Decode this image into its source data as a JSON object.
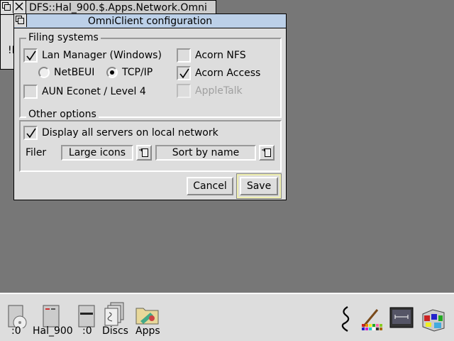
{
  "background_window": {
    "title": "DFS::Hal_900.$.Apps.Network.Omni",
    "content_fragment": "!L"
  },
  "dialog": {
    "title": "OmniClient configuration",
    "filing_systems": {
      "label": "Filing systems",
      "lan_manager": {
        "label": "Lan Manager (Windows)",
        "checked": true
      },
      "netbeui": {
        "label": "NetBEUI",
        "selected": false
      },
      "tcpip": {
        "label": "TCP/IP",
        "selected": true
      },
      "aun_econet": {
        "label": "AUN Econet / Level 4",
        "checked": false
      },
      "acorn_nfs": {
        "label": "Acorn NFS",
        "checked": false
      },
      "acorn_access": {
        "label": "Acorn Access",
        "checked": true
      },
      "appletalk": {
        "label": "AppleTalk",
        "checked": false,
        "disabled": true
      }
    },
    "other_options": {
      "label": "Other options",
      "display_servers": {
        "label": "Display all servers on local network",
        "checked": true
      },
      "filer_label": "Filer",
      "display_mode": "Large icons",
      "sort_mode": "Sort by name"
    },
    "cancel_label": "Cancel",
    "save_label": "Save"
  },
  "iconbar": {
    "items_left": [
      {
        "label": ":0",
        "icon": "cd-drive-icon"
      },
      {
        "label": "Hal_900",
        "icon": "hard-disc-icon"
      },
      {
        "label": ":0",
        "icon": "floppy-drive-icon"
      },
      {
        "label": "Discs",
        "icon": "discs-icon"
      },
      {
        "label": "Apps",
        "icon": "apps-folder-icon"
      }
    ],
    "items_right": [
      "omniclient-icon",
      "paint-icon",
      "display-manager-icon",
      "task-manager-icon"
    ]
  }
}
